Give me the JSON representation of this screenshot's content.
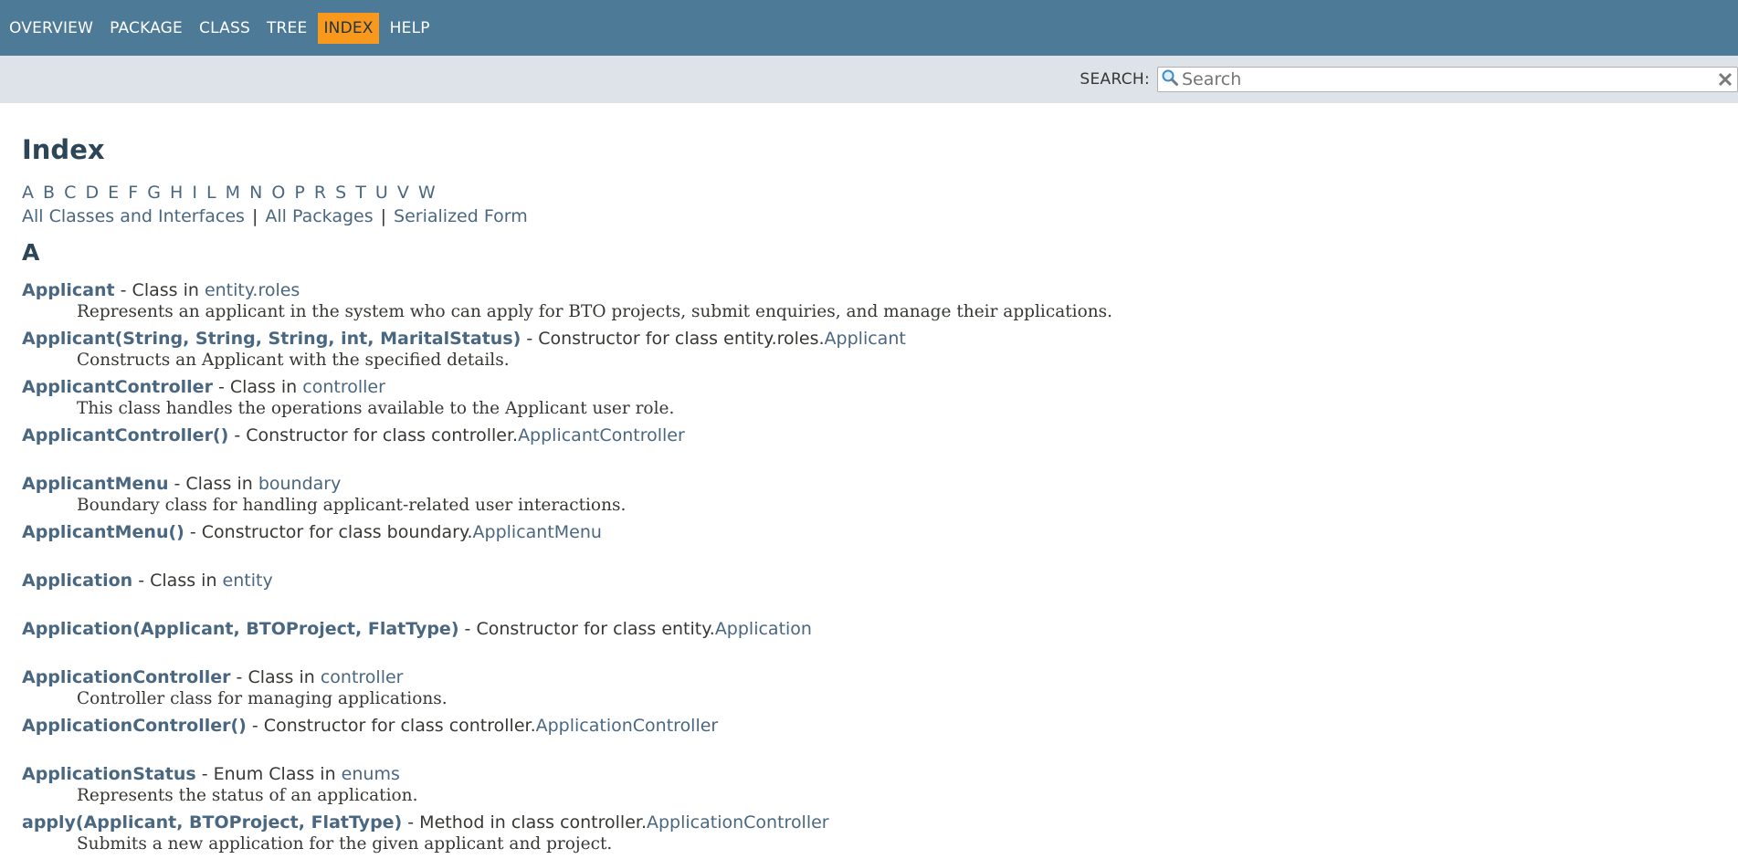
{
  "topnav": {
    "items": [
      {
        "label": "OVERVIEW",
        "active": false
      },
      {
        "label": "PACKAGE",
        "active": false
      },
      {
        "label": "CLASS",
        "active": false
      },
      {
        "label": "TREE",
        "active": false
      },
      {
        "label": "INDEX",
        "active": true
      },
      {
        "label": "HELP",
        "active": false
      }
    ]
  },
  "search": {
    "label": "SEARCH:",
    "placeholder": "Search"
  },
  "page": {
    "title": "Index",
    "letters": [
      "A",
      "B",
      "C",
      "D",
      "E",
      "F",
      "G",
      "H",
      "I",
      "L",
      "M",
      "N",
      "O",
      "P",
      "R",
      "S",
      "T",
      "U",
      "V",
      "W"
    ],
    "all_links": [
      "All Classes and Interfaces",
      "All Packages",
      "Serialized Form"
    ],
    "separator": "|",
    "section_letter": "A"
  },
  "entries": [
    {
      "name": "Applicant",
      "kind": " - Class in ",
      "qual": "",
      "link": "entity.roles",
      "desc": "Represents an applicant in the system who can apply for BTO projects, submit enquiries, and manage their applications."
    },
    {
      "name": "Applicant(String, String, String, int, MaritalStatus)",
      "kind": " - Constructor for class ",
      "qual": "entity.roles.",
      "link": "Applicant",
      "desc": "Constructs an Applicant with the specified details."
    },
    {
      "name": "ApplicantController",
      "kind": " - Class in ",
      "qual": "",
      "link": "controller",
      "desc": "This class handles the operations available to the Applicant user role."
    },
    {
      "name": "ApplicantController()",
      "kind": " - Constructor for class ",
      "qual": "controller.",
      "link": "ApplicantController",
      "desc": ""
    },
    {
      "name": "ApplicantMenu",
      "kind": " - Class in ",
      "qual": "",
      "link": "boundary",
      "desc": "Boundary class for handling applicant-related user interactions."
    },
    {
      "name": "ApplicantMenu()",
      "kind": " - Constructor for class ",
      "qual": "boundary.",
      "link": "ApplicantMenu",
      "desc": ""
    },
    {
      "name": "Application",
      "kind": " - Class in ",
      "qual": "",
      "link": "entity",
      "desc": ""
    },
    {
      "name": "Application(Applicant, BTOProject, FlatType)",
      "kind": " - Constructor for class ",
      "qual": "entity.",
      "link": "Application",
      "desc": ""
    },
    {
      "name": "ApplicationController",
      "kind": " - Class in ",
      "qual": "",
      "link": "controller",
      "desc": "Controller class for managing applications."
    },
    {
      "name": "ApplicationController()",
      "kind": " - Constructor for class ",
      "qual": "controller.",
      "link": "ApplicationController",
      "desc": ""
    },
    {
      "name": "ApplicationStatus",
      "kind": " - Enum Class in ",
      "qual": "",
      "link": "enums",
      "desc": "Represents the status of an application."
    },
    {
      "name": "apply(Applicant, BTOProject, FlatType)",
      "kind": " - Method in class ",
      "qual": "controller.",
      "link": "ApplicationController",
      "desc": "Submits a new application for the given applicant and project."
    }
  ]
}
